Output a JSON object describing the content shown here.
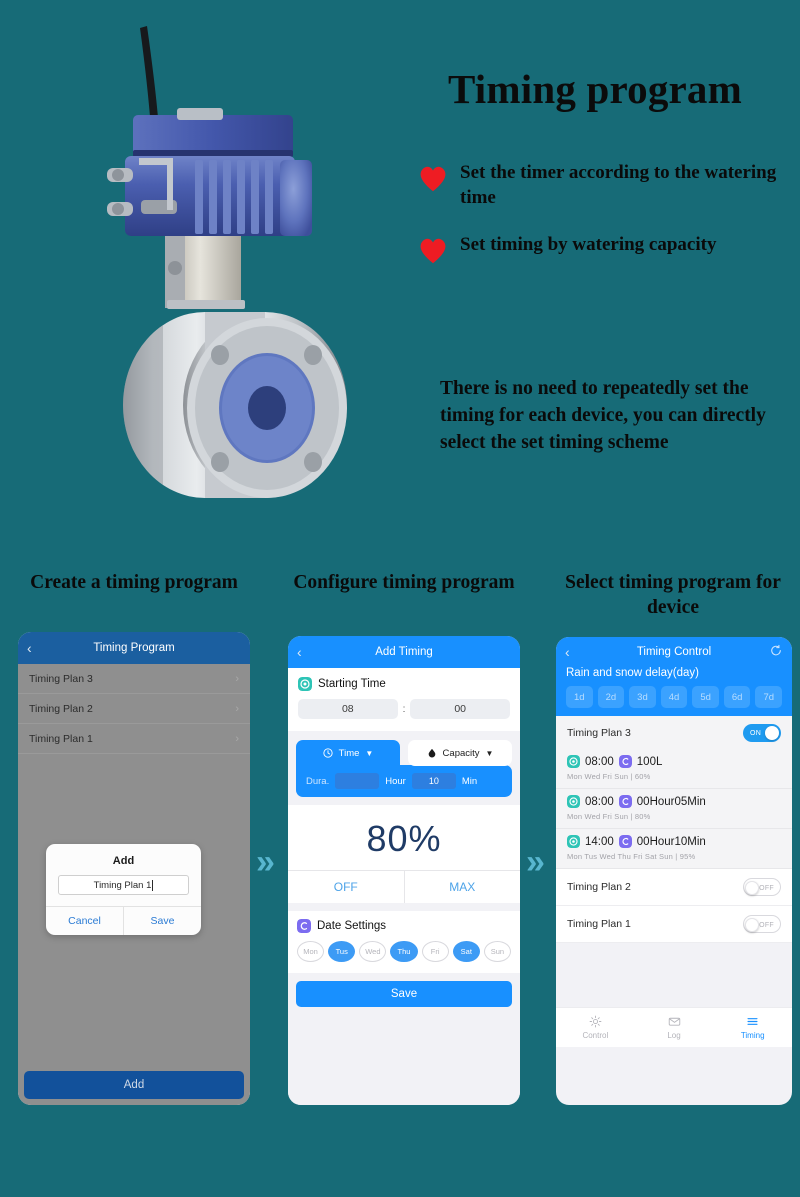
{
  "hero": {
    "headline": "Timing program",
    "bullets": [
      "Set the timer according to the watering time",
      "Set timing by watering capacity"
    ],
    "paragraph": "There is no need to repeatedly set the timing for each device, you can directly select the set timing scheme",
    "heart_color": "#ee1c23",
    "background_color": "#176b77"
  },
  "captions": {
    "step1": "Create a timing program",
    "step2": "Configure timing program",
    "step3": "Select timing program for device"
  },
  "arrows": {
    "glyph": "»",
    "color": "#58b6cf"
  },
  "phone1": {
    "header_title": "Timing Program",
    "back_glyph": "‹",
    "list": [
      {
        "label": "Timing Plan 3",
        "chevron": "›"
      },
      {
        "label": "Timing Plan 2",
        "chevron": "›"
      },
      {
        "label": "Timing Plan 1",
        "chevron": "›"
      }
    ],
    "modal": {
      "title": "Add",
      "input_value": "Timing Plan 1",
      "cancel_label": "Cancel",
      "save_label": "Save"
    },
    "add_button": "Add"
  },
  "phone2": {
    "header_title": "Add Timing",
    "back_glyph": "‹",
    "starting_time": {
      "label": "Starting Time",
      "hour": "08",
      "minute": "00",
      "separator": ":"
    },
    "mode_tabs": [
      {
        "label": "Time",
        "icon": "clock-icon",
        "active": true
      },
      {
        "label": "Capacity",
        "icon": "droplet-icon",
        "active": false
      }
    ],
    "duration": {
      "label": "Dura.",
      "hour_value": "",
      "hour_unit": "Hour",
      "min_value": "10",
      "min_unit": "Min"
    },
    "percent": {
      "value": "80%",
      "off_label": "OFF",
      "max_label": "MAX"
    },
    "date_settings": {
      "label": "Date Settings",
      "days": [
        {
          "label": "Mon",
          "selected": false
        },
        {
          "label": "Tus",
          "selected": true
        },
        {
          "label": "Wed",
          "selected": false
        },
        {
          "label": "Thu",
          "selected": true
        },
        {
          "label": "Fri",
          "selected": false
        },
        {
          "label": "Sat",
          "selected": true
        },
        {
          "label": "Sun",
          "selected": false
        }
      ]
    },
    "save_label": "Save"
  },
  "phone3": {
    "header_title": "Timing Control",
    "back_glyph": "‹",
    "refresh_icon": "refresh-icon",
    "delay_label": "Rain and snow delay(day)",
    "delay_days": [
      "1d",
      "2d",
      "3d",
      "4d",
      "5d",
      "6d",
      "7d"
    ],
    "active_plan": {
      "title": "Timing Plan 3",
      "toggle_label": "ON",
      "toggle_on": true,
      "entries": [
        {
          "time": "08:00",
          "amount": "100L",
          "days": "Mon  Wed  Fri  Sun  |  60%"
        },
        {
          "time": "08:00",
          "amount": "00Hour05Min",
          "days": "Mon  Wed  Fri  Sun  |  80%"
        },
        {
          "time": "14:00",
          "amount": "00Hour10Min",
          "days": "Mon  Tus  Wed  Thu  Fri  Sat  Sun  |  95%"
        }
      ]
    },
    "other_plans": [
      {
        "title": "Timing Plan 2",
        "toggle_label": "OFF",
        "toggle_on": false
      },
      {
        "title": "Timing Plan 1",
        "toggle_label": "OFF",
        "toggle_on": false
      }
    ],
    "tabs": [
      {
        "label": "Control",
        "icon": "gear-icon",
        "active": false
      },
      {
        "label": "Log",
        "icon": "mail-icon",
        "active": false
      },
      {
        "label": "Timing",
        "icon": "list-icon",
        "active": true
      }
    ]
  }
}
